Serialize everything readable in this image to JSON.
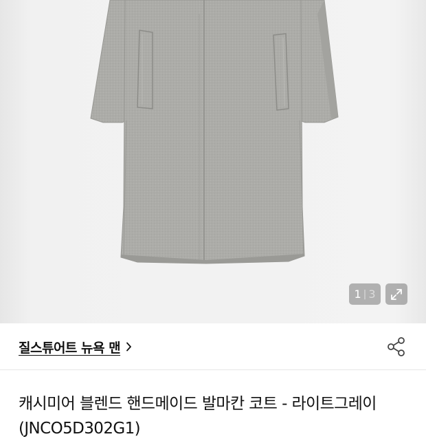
{
  "gallery": {
    "page_current": "1",
    "page_separator": "|",
    "page_total": "3",
    "image_alt": "coat-photo"
  },
  "brand": {
    "name": "질스튜어트 뉴욕 맨"
  },
  "product": {
    "title": "캐시미어 블렌드 핸드메이드 발마칸 코트 - 라이트그레이 (JNCO5D302G1)"
  },
  "icons": {
    "expand": "expand-icon",
    "share": "share-icon",
    "chevron": "chevron-right-icon"
  },
  "colors": {
    "coat": "#aaaaa6",
    "background": "#f2f2f2",
    "text": "#111111"
  }
}
